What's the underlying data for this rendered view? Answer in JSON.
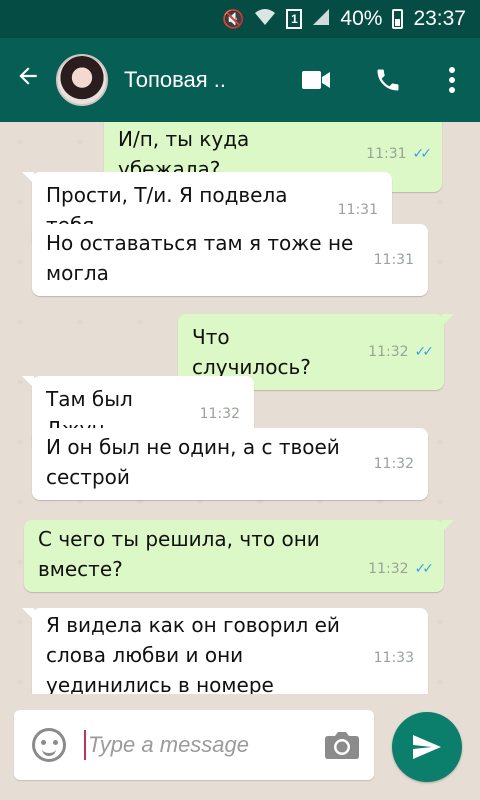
{
  "status_bar": {
    "battery": "40%",
    "time": "23:37",
    "sim_slot": "1"
  },
  "header": {
    "contact_name": "Топовая ..",
    "back_icon": "arrow-left-icon",
    "video_icon": "video-icon",
    "call_icon": "phone-icon",
    "menu_icon": "more-vert-icon"
  },
  "messages": [
    {
      "dir": "out",
      "text": "И/п, ты куда убежала?",
      "time": "11:31",
      "read": true
    },
    {
      "dir": "in",
      "text": "Прости, Т/и. Я подвела тебя",
      "time": "11:31"
    },
    {
      "dir": "in",
      "text": "Но оставаться там я тоже не могла",
      "time": "11:31"
    },
    {
      "dir": "out",
      "text": "Что случилось?",
      "time": "11:32",
      "read": true
    },
    {
      "dir": "in",
      "text": "Там был Джун",
      "time": "11:32"
    },
    {
      "dir": "in",
      "text": "И он был не один, а с твоей сестрой",
      "time": "11:32"
    },
    {
      "dir": "out",
      "text": "С чего ты решила, что они вместе?",
      "time": "11:32",
      "read": true
    },
    {
      "dir": "in",
      "text": "Я видела как он говорил ей слова любви и они уединились в номере",
      "time": "11:33"
    }
  ],
  "input": {
    "placeholder": "Type a message"
  },
  "colors": {
    "header": "#075e54",
    "statusbar": "#054d44",
    "outgoing": "#dcf8c6",
    "incoming": "#ffffff",
    "send": "#0b7e6c",
    "read_ticks": "#3fa3e5"
  }
}
